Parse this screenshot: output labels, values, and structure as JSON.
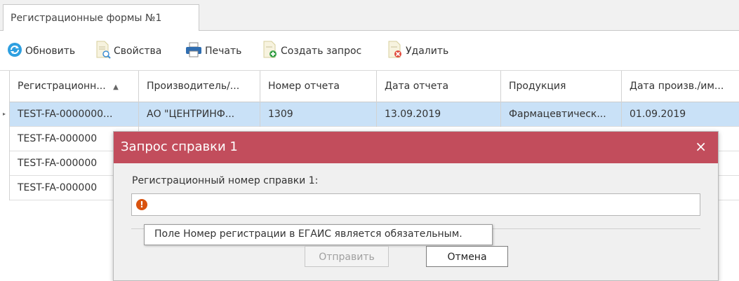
{
  "tab": {
    "label": "Регистрационные формы №1"
  },
  "toolbar": {
    "refresh": "Обновить",
    "properties": "Свойства",
    "print": "Печать",
    "create_request": "Создать запрос",
    "delete": "Удалить"
  },
  "icons": {
    "refresh": "refresh-icon",
    "properties": "document-search-icon",
    "print": "printer-icon",
    "create_request": "document-add-icon",
    "delete": "document-delete-icon",
    "sort": "sort-ascending-icon",
    "error": "error-icon",
    "close": "close-icon"
  },
  "colors": {
    "dialog_title_bg": "#c24d5c",
    "selected_row_bg": "#c9e1f7",
    "refresh_icon": "#2e9fe0",
    "error_icon": "#d9530f"
  },
  "grid": {
    "columns": [
      "Регистрационн...",
      "Производитель/...",
      "Номер отчета",
      "Дата отчета",
      "Продукция",
      "Дата произв./им..."
    ],
    "sort_indicator": "▲",
    "rows": [
      [
        "TEST-FA-0000000...",
        "АО \"ЦЕНТРИНФ...",
        "1309",
        "13.09.2019",
        "Фармацевтическ...",
        "01.09.2019"
      ],
      [
        "TEST-FA-000000",
        "",
        "",
        "",
        "",
        ""
      ],
      [
        "TEST-FA-000000",
        "",
        "",
        "",
        "",
        ""
      ],
      [
        "TEST-FA-000000",
        "",
        "",
        "",
        "",
        ""
      ]
    ]
  },
  "dialog": {
    "title": "Запрос справки 1",
    "close": "×",
    "field_label": "Регистрационный номер справки 1:",
    "field_value": "",
    "error_glyph": "!",
    "tooltip": "Поле Номер регистрации в ЕГАИС является обязательным.",
    "send": "Отправить",
    "cancel": "Отмена"
  }
}
